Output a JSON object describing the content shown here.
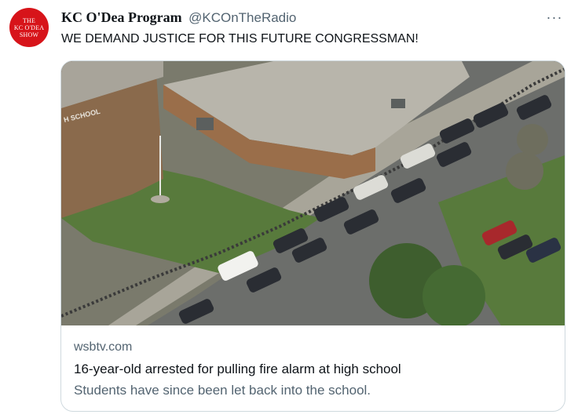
{
  "tweet": {
    "avatar_lines": [
      "THE",
      "KC O'DEA",
      "SHOW"
    ],
    "display_name": "KC O'Dea Program",
    "handle": "@KCOnTheRadio",
    "more_glyph": "···",
    "text": "WE DEMAND JUSTICE FOR THIS FUTURE CONGRESSMAN!"
  },
  "card": {
    "image_sign_text": "H SCHOOL",
    "domain": "wsbtv.com",
    "title": "16-year-old arrested for pulling fire alarm at high school",
    "description": "Students have since been let back into the school."
  },
  "colors": {
    "avatar_red": "#d7141a",
    "text_primary": "#0f1419",
    "text_secondary": "#536471",
    "border": "#cfd9de"
  }
}
